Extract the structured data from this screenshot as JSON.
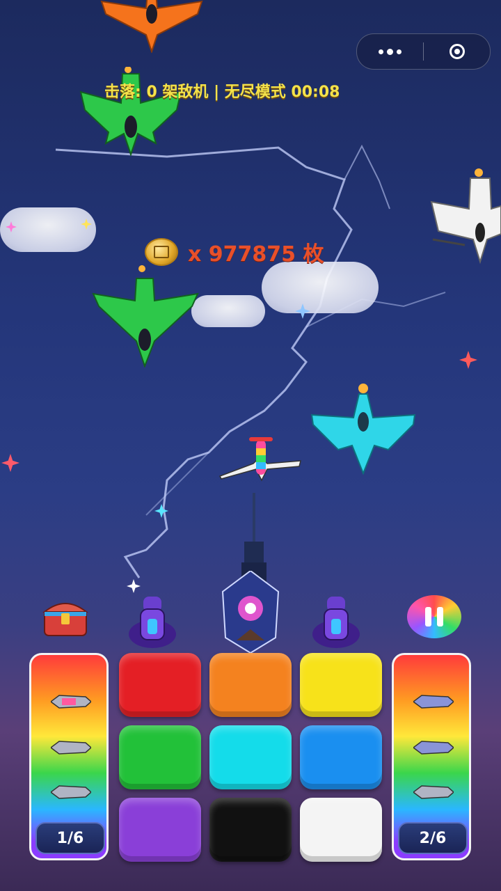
{
  "hud": {
    "kills_text": "击落: 0 架敌机 | 无尽模式 00:08",
    "coins_text": "x 977875 枚"
  },
  "capsule": {
    "menu_icon": "more-dots-icon",
    "close_icon": "target-ring-icon"
  },
  "left_missile_panel": {
    "counter": "1/6",
    "missiles": 3
  },
  "right_missile_panel": {
    "counter": "2/6",
    "missiles": 3
  },
  "color_tiles": [
    {
      "name": "red",
      "color": "#e41f25"
    },
    {
      "name": "orange",
      "color": "#f4821f"
    },
    {
      "name": "yellow",
      "color": "#f7e21a"
    },
    {
      "name": "green",
      "color": "#22c139"
    },
    {
      "name": "cyan",
      "color": "#14dcea"
    },
    {
      "name": "blue",
      "color": "#1a8ff0"
    },
    {
      "name": "purple",
      "color": "#8a3fd8"
    },
    {
      "name": "black",
      "color": "#111111"
    },
    {
      "name": "white",
      "color": "#f4f4f4"
    }
  ],
  "planes": [
    {
      "name": "orange-jet",
      "color": "#f5731c"
    },
    {
      "name": "green-jet-top",
      "color": "#2dc84a"
    },
    {
      "name": "white-jet",
      "color": "#f2f2f2"
    },
    {
      "name": "green-jet-mid",
      "color": "#2dc84a"
    },
    {
      "name": "cyan-jet",
      "color": "#2fd6e8"
    },
    {
      "name": "rainbow-plane",
      "color": "#ff4d9e"
    }
  ],
  "icons": [
    "treasure-chest-icon",
    "pause-icon",
    "turret-icon",
    "crystal-icon"
  ]
}
